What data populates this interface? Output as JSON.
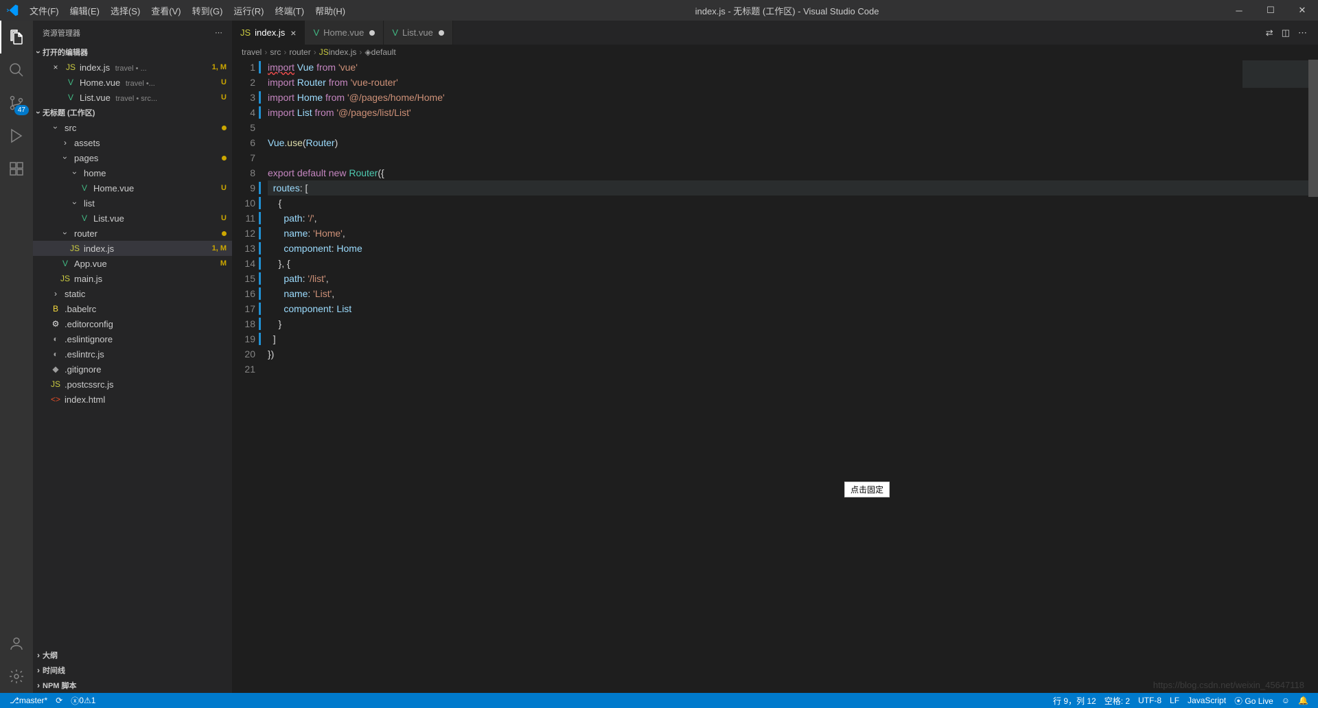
{
  "title": "index.js - 无标题 (工作区) - Visual Studio Code",
  "menu": [
    "文件(F)",
    "编辑(E)",
    "选择(S)",
    "查看(V)",
    "转到(G)",
    "运行(R)",
    "终端(T)",
    "帮助(H)"
  ],
  "sidebar": {
    "title": "资源管理器",
    "open_editors": "打开的编辑器",
    "workspace": "无标题 (工作区)",
    "open_list": [
      {
        "icon": "JS",
        "iconClass": "ic-js",
        "name": "index.js",
        "meta": "travel • ... ",
        "status": "1, M",
        "close": true
      },
      {
        "icon": "V",
        "iconClass": "ic-vue",
        "name": "Home.vue",
        "meta": "travel •...",
        "status": "U"
      },
      {
        "icon": "V",
        "iconClass": "ic-vue",
        "name": "List.vue",
        "meta": "travel • src...",
        "status": "U"
      }
    ],
    "tree": [
      {
        "ind": 1,
        "chev": "d",
        "name": "src",
        "dot": true
      },
      {
        "ind": 2,
        "chev": "r",
        "name": "assets"
      },
      {
        "ind": 2,
        "chev": "d",
        "name": "pages",
        "dot": true
      },
      {
        "ind": 3,
        "chev": "d",
        "name": "home"
      },
      {
        "ind": 4,
        "icon": "V",
        "iconClass": "ic-vue",
        "name": "Home.vue",
        "status": "U"
      },
      {
        "ind": 3,
        "chev": "d",
        "name": "list"
      },
      {
        "ind": 4,
        "icon": "V",
        "iconClass": "ic-vue",
        "name": "List.vue",
        "status": "U"
      },
      {
        "ind": 2,
        "chev": "d",
        "name": "router",
        "dot": true
      },
      {
        "ind": 3,
        "icon": "JS",
        "iconClass": "ic-js",
        "name": "index.js",
        "status": "1, M",
        "selected": true
      },
      {
        "ind": 2,
        "icon": "V",
        "iconClass": "ic-vue",
        "name": "App.vue",
        "status": "M"
      },
      {
        "ind": 2,
        "icon": "JS",
        "iconClass": "ic-js",
        "name": "main.js"
      },
      {
        "ind": 1,
        "chev": "r",
        "name": "static"
      },
      {
        "ind": 1,
        "icon": "B",
        "iconClass": "ic-babel",
        "name": ".babelrc"
      },
      {
        "ind": 1,
        "icon": "⚙",
        "iconClass": "ic-ed",
        "name": ".editorconfig"
      },
      {
        "ind": 1,
        "icon": "◐",
        "iconClass": "ic-conf",
        "name": ".eslintignore"
      },
      {
        "ind": 1,
        "icon": "◐",
        "iconClass": "ic-conf",
        "name": ".eslintrc.js"
      },
      {
        "ind": 1,
        "icon": "◆",
        "iconClass": "ic-conf",
        "name": ".gitignore"
      },
      {
        "ind": 1,
        "icon": "JS",
        "iconClass": "ic-js",
        "name": ".postcssrc.js"
      },
      {
        "ind": 1,
        "icon": "<>",
        "iconClass": "ic-html",
        "name": "index.html"
      }
    ],
    "sections": [
      "大纲",
      "时间线",
      "NPM 脚本"
    ]
  },
  "scm_badge": "47",
  "tabs": [
    {
      "icon": "JS",
      "iconClass": "ic-js",
      "label": "index.js",
      "active": true,
      "close": true
    },
    {
      "icon": "V",
      "iconClass": "ic-vue",
      "label": "Home.vue",
      "dirty": true
    },
    {
      "icon": "V",
      "iconClass": "ic-vue",
      "label": "List.vue",
      "dirty": true
    }
  ],
  "breadcrumb": [
    "travel",
    "src",
    "router",
    "index.js",
    "default"
  ],
  "breadcrumb_icons": [
    "",
    "",
    "",
    "JS",
    "◈"
  ],
  "code": [
    {
      "n": 1,
      "mod": true,
      "seg": [
        [
          "t-kw wavy",
          "import"
        ],
        [
          "t-p",
          " "
        ],
        [
          "t-var",
          "Vue"
        ],
        [
          "t-p",
          " "
        ],
        [
          "t-kw",
          "from"
        ],
        [
          "t-p",
          " "
        ],
        [
          "t-str",
          "'vue'"
        ]
      ]
    },
    {
      "n": 2,
      "seg": [
        [
          "t-kw",
          "import"
        ],
        [
          "t-p",
          " "
        ],
        [
          "t-var",
          "Router"
        ],
        [
          "t-p",
          " "
        ],
        [
          "t-kw",
          "from"
        ],
        [
          "t-p",
          " "
        ],
        [
          "t-str",
          "'vue-router'"
        ]
      ]
    },
    {
      "n": 3,
      "mod": true,
      "seg": [
        [
          "t-kw",
          "import"
        ],
        [
          "t-p",
          " "
        ],
        [
          "t-var",
          "Home"
        ],
        [
          "t-p",
          " "
        ],
        [
          "t-kw",
          "from"
        ],
        [
          "t-p",
          " "
        ],
        [
          "t-str",
          "'@/pages/home/Home'"
        ]
      ]
    },
    {
      "n": 4,
      "mod": true,
      "seg": [
        [
          "t-kw",
          "import"
        ],
        [
          "t-p",
          " "
        ],
        [
          "t-var",
          "List"
        ],
        [
          "t-p",
          " "
        ],
        [
          "t-kw",
          "from"
        ],
        [
          "t-p",
          " "
        ],
        [
          "t-str",
          "'@/pages/list/List'"
        ]
      ]
    },
    {
      "n": 5,
      "seg": []
    },
    {
      "n": 6,
      "seg": [
        [
          "t-var",
          "Vue"
        ],
        [
          "t-p",
          "."
        ],
        [
          "t-fn",
          "use"
        ],
        [
          "t-p",
          "("
        ],
        [
          "t-var",
          "Router"
        ],
        [
          "t-p",
          ")"
        ]
      ]
    },
    {
      "n": 7,
      "seg": []
    },
    {
      "n": 8,
      "seg": [
        [
          "t-kw",
          "export"
        ],
        [
          "t-p",
          " "
        ],
        [
          "t-kw",
          "default"
        ],
        [
          "t-p",
          " "
        ],
        [
          "t-kw",
          "new"
        ],
        [
          "t-p",
          " "
        ],
        [
          "t-type",
          "Router"
        ],
        [
          "t-p",
          "({"
        ]
      ]
    },
    {
      "n": 9,
      "mod": true,
      "current": true,
      "seg": [
        [
          "t-p",
          "  "
        ],
        [
          "t-var",
          "routes"
        ],
        [
          "t-p",
          ": ["
        ]
      ]
    },
    {
      "n": 10,
      "mod": true,
      "seg": [
        [
          "t-p",
          "    {"
        ]
      ]
    },
    {
      "n": 11,
      "mod": true,
      "seg": [
        [
          "t-p",
          "      "
        ],
        [
          "t-var",
          "path"
        ],
        [
          "t-p",
          ": "
        ],
        [
          "t-str",
          "'/'"
        ],
        [
          "t-p",
          ","
        ]
      ]
    },
    {
      "n": 12,
      "mod": true,
      "seg": [
        [
          "t-p",
          "      "
        ],
        [
          "t-var",
          "name"
        ],
        [
          "t-p",
          ": "
        ],
        [
          "t-str",
          "'Home'"
        ],
        [
          "t-p",
          ","
        ]
      ]
    },
    {
      "n": 13,
      "mod": true,
      "seg": [
        [
          "t-p",
          "      "
        ],
        [
          "t-var",
          "component"
        ],
        [
          "t-p",
          ": "
        ],
        [
          "t-var",
          "Home"
        ]
      ]
    },
    {
      "n": 14,
      "mod": true,
      "seg": [
        [
          "t-p",
          "    }, {"
        ]
      ]
    },
    {
      "n": 15,
      "mod": true,
      "seg": [
        [
          "t-p",
          "      "
        ],
        [
          "t-var",
          "path"
        ],
        [
          "t-p",
          ": "
        ],
        [
          "t-str",
          "'/list'"
        ],
        [
          "t-p",
          ","
        ]
      ]
    },
    {
      "n": 16,
      "mod": true,
      "seg": [
        [
          "t-p",
          "      "
        ],
        [
          "t-var",
          "name"
        ],
        [
          "t-p",
          ": "
        ],
        [
          "t-str",
          "'List'"
        ],
        [
          "t-p",
          ","
        ]
      ]
    },
    {
      "n": 17,
      "mod": true,
      "seg": [
        [
          "t-p",
          "      "
        ],
        [
          "t-var",
          "component"
        ],
        [
          "t-p",
          ": "
        ],
        [
          "t-var",
          "List"
        ]
      ]
    },
    {
      "n": 18,
      "mod": true,
      "seg": [
        [
          "t-p",
          "    }"
        ]
      ]
    },
    {
      "n": 19,
      "mod": true,
      "seg": [
        [
          "t-p",
          "  ]"
        ]
      ]
    },
    {
      "n": 20,
      "seg": [
        [
          "t-p",
          "})"
        ]
      ]
    },
    {
      "n": 21,
      "seg": []
    }
  ],
  "tooltip": "点击固定",
  "status": {
    "branch": "master*",
    "sync": "⟳",
    "errors": "0",
    "warnings": "1",
    "pos": "行 9，列 12",
    "spaces": "空格: 2",
    "encoding": "UTF-8",
    "eol": "LF",
    "lang": "JavaScript",
    "golive": "⦿ Go Live",
    "feedback": "☺",
    "bell": "🔔"
  },
  "watermark": "https://blog.csdn.net/weixin_45647118"
}
